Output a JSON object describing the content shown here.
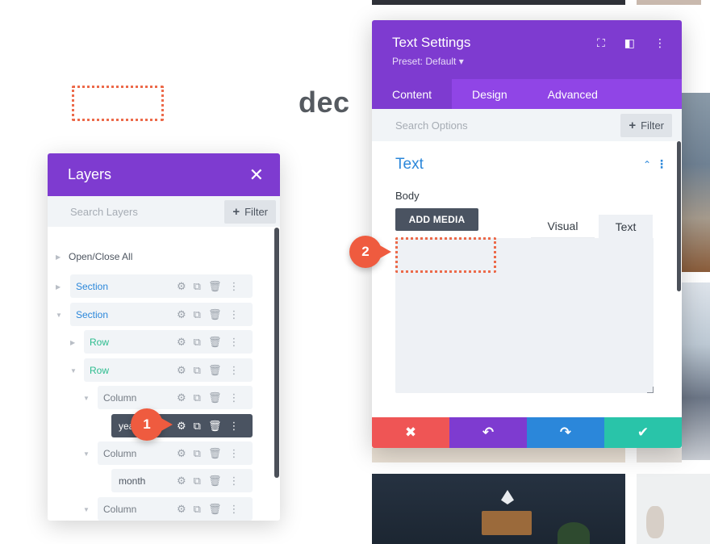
{
  "canvas": {
    "heading": "dec"
  },
  "layers_panel": {
    "title": "Layers",
    "search_placeholder": "Search Layers",
    "filter_label": "Filter",
    "open_close_all": "Open/Close All",
    "items": [
      {
        "label": "Section",
        "type": "section",
        "expanded": false
      },
      {
        "label": "Section",
        "type": "section",
        "expanded": true
      },
      {
        "label": "Row",
        "type": "row",
        "expanded": false
      },
      {
        "label": "Row",
        "type": "row",
        "expanded": true
      },
      {
        "label": "Column",
        "type": "column",
        "expanded": true
      },
      {
        "label": "year",
        "type": "module",
        "selected": true
      },
      {
        "label": "Column",
        "type": "column",
        "expanded": true
      },
      {
        "label": "month",
        "type": "module"
      },
      {
        "label": "Column",
        "type": "column",
        "expanded": true
      }
    ]
  },
  "callouts": {
    "one": "1",
    "two": "2"
  },
  "text_settings": {
    "title": "Text Settings",
    "preset": "Preset: Default ▾",
    "tabs": [
      "Content",
      "Design",
      "Advanced"
    ],
    "active_tab": "Content",
    "search_placeholder": "Search Options",
    "filter_label": "Filter",
    "section_title": "Text",
    "body_label": "Body",
    "add_media_label": "ADD MEDIA",
    "editor_tabs": [
      "Visual",
      "Text"
    ],
    "active_editor_tab": "Text",
    "body_value": ""
  },
  "colors": {
    "purple_header": "#7e3bd0",
    "purple_tabs": "#9045e6",
    "section_blue": "#2b87da",
    "row_green": "#2bbc8e",
    "callout_orange": "#ef5b3f",
    "cancel_red": "#ef5555",
    "undo_purple": "#7e3bd0",
    "redo_blue": "#2b87da",
    "save_green": "#29c4a9"
  },
  "icons": [
    "close-icon",
    "plus-icon",
    "gear-icon",
    "duplicate-icon",
    "trash-icon",
    "more-dots-icon",
    "caret-right-icon",
    "caret-down-icon",
    "fullscreen-icon",
    "sidebar-icon",
    "chevron-up-icon",
    "undo-icon",
    "redo-icon",
    "check-icon"
  ]
}
